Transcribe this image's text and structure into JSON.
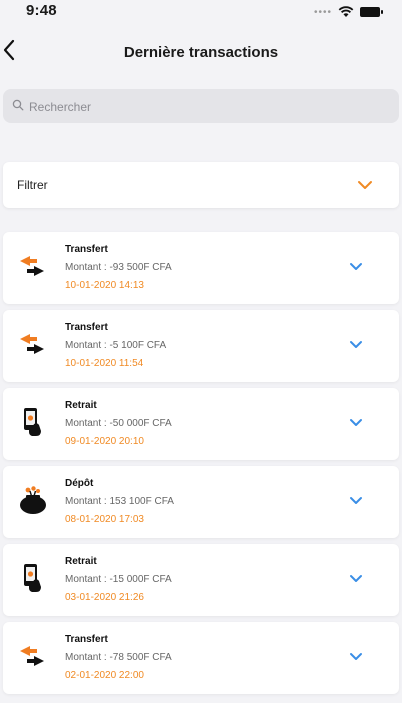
{
  "status_bar": {
    "time": "9:48"
  },
  "nav": {
    "title": "Dernière transactions"
  },
  "search": {
    "placeholder": "Rechercher"
  },
  "filter": {
    "label": "Filtrer"
  },
  "colors": {
    "accent_orange": "#f08a24",
    "chevron_blue": "#3a8ee6"
  },
  "transactions": [
    {
      "type": "Transfert",
      "amount": "Montant : -93 500F CFA",
      "date": "10-01-2020 14:13",
      "icon": "transfer-arrows-icon"
    },
    {
      "type": "Transfert",
      "amount": "Montant : -5 100F CFA",
      "date": "10-01-2020 11:54",
      "icon": "transfer-arrows-icon"
    },
    {
      "type": "Retrait",
      "amount": "Montant : -50 000F CFA",
      "date": "09-01-2020 20:10",
      "icon": "phone-hand-icon"
    },
    {
      "type": "Dépôt",
      "amount": "Montant : 153 100F CFA",
      "date": "08-01-2020 17:03",
      "icon": "purse-icon"
    },
    {
      "type": "Retrait",
      "amount": "Montant : -15 000F CFA",
      "date": "03-01-2020 21:26",
      "icon": "phone-hand-icon"
    },
    {
      "type": "Transfert",
      "amount": "Montant : -78 500F CFA",
      "date": "02-01-2020 22:00",
      "icon": "transfer-arrows-icon"
    }
  ]
}
